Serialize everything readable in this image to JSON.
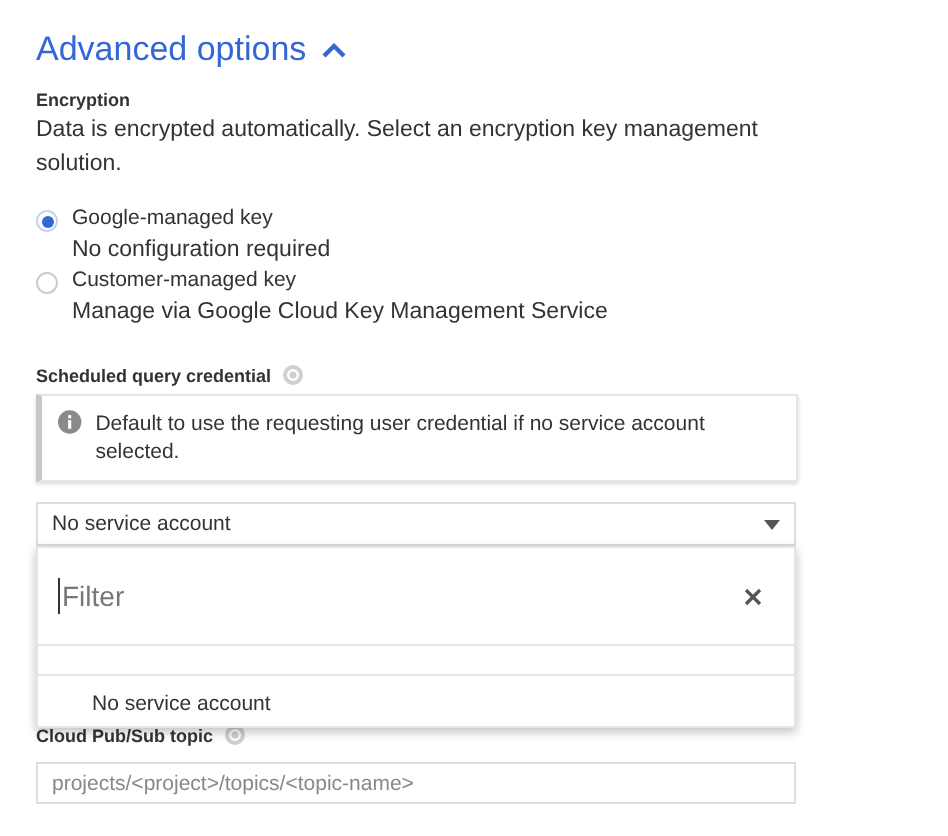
{
  "section": {
    "title": "Advanced options",
    "expanded": true
  },
  "encryption": {
    "label": "Encryption",
    "description": "Data is encrypted automatically. Select an encryption key management solution.",
    "options": [
      {
        "label": "Google-managed key",
        "detail": "No configuration required",
        "selected": true
      },
      {
        "label": "Customer-managed key",
        "detail": "Manage via Google Cloud Key Management Service",
        "selected": false
      }
    ]
  },
  "credential": {
    "label": "Scheduled query credential",
    "info": "Default to use the requesting user credential if no service account selected.",
    "value": "No service account",
    "expanded": true,
    "menu": {
      "filter_placeholder": "Filter",
      "items": [
        "No service account"
      ]
    }
  },
  "pubsub": {
    "label": "Cloud Pub/Sub topic",
    "placeholder": "projects/<project>/topics/<topic-name>"
  }
}
